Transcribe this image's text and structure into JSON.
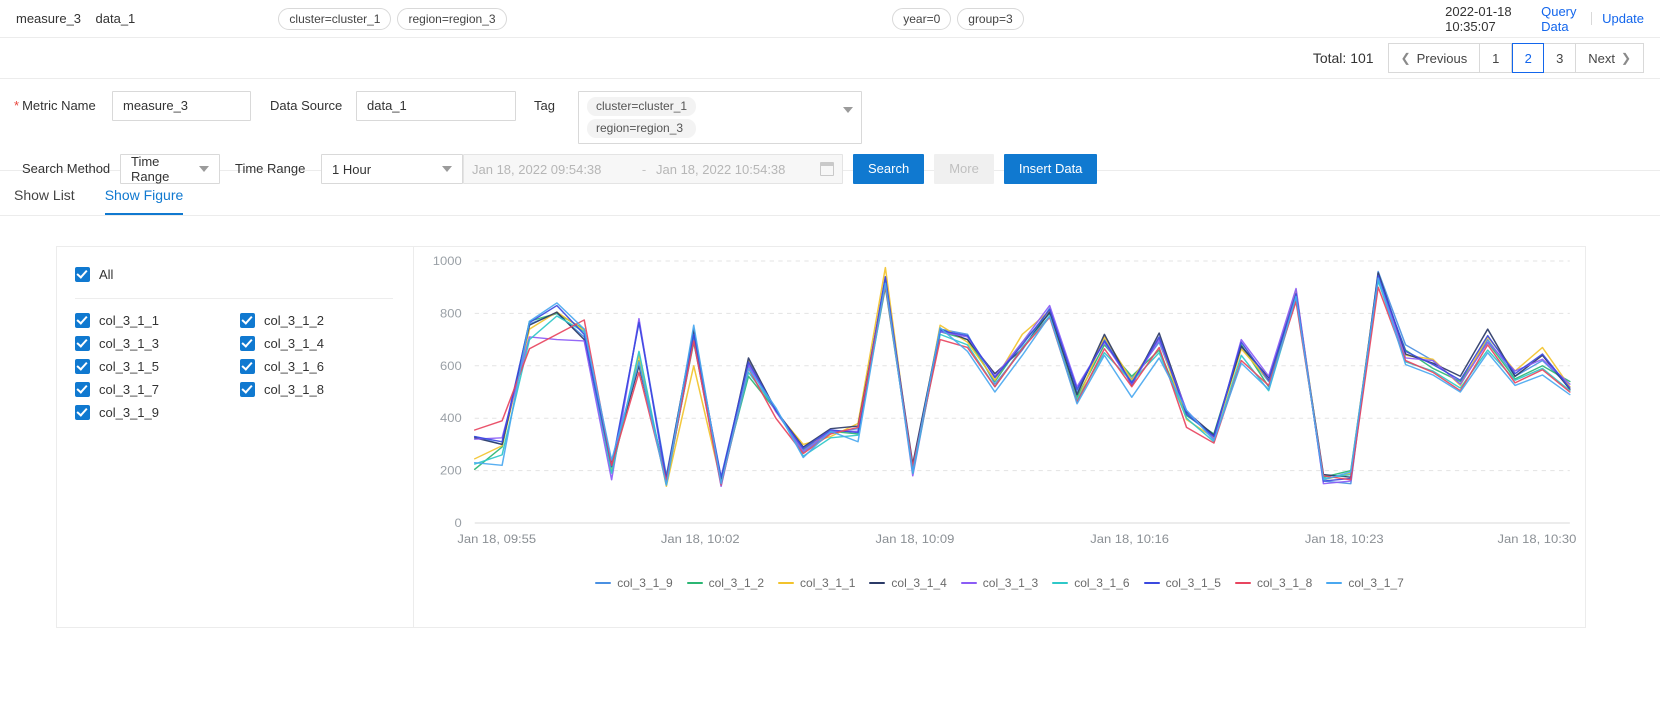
{
  "topbar": {
    "measure": "measure_3",
    "data_source": "data_1",
    "tags": [
      "cluster=cluster_1",
      "region=region_3"
    ],
    "tags2": [
      "year=0",
      "group=3"
    ],
    "timestamp": "2022-01-18 10:35:07",
    "query_data_link": "Query Data",
    "update_link": "Update"
  },
  "pagination": {
    "total_label": "Total: 101",
    "previous_label": "Previous",
    "next_label": "Next",
    "pages": [
      "1",
      "2",
      "3"
    ],
    "current_page": "2"
  },
  "form": {
    "metric_name_label": "Metric Name",
    "metric_name_value": "measure_3",
    "data_source_label": "Data Source",
    "data_source_value": "data_1",
    "tag_label": "Tag",
    "tag_values": [
      "cluster=cluster_1",
      "region=region_3"
    ],
    "search_method_label": "Search Method",
    "search_method_value": "Time Range",
    "time_range_label": "Time Range",
    "time_range_value": "1 Hour",
    "date_start_placeholder": "Jan 18, 2022 09:54:38",
    "date_sep": "-",
    "date_end_placeholder": "Jan 18, 2022 10:54:38",
    "search_button": "Search",
    "more_button": "More",
    "insert_data_button": "Insert Data"
  },
  "tabs": [
    {
      "label": "Show List",
      "active": false
    },
    {
      "label": "Show Figure",
      "active": true
    }
  ],
  "series_selector": {
    "all_label": "All",
    "items": [
      "col_3_1_1",
      "col_3_1_2",
      "col_3_1_3",
      "col_3_1_4",
      "col_3_1_5",
      "col_3_1_6",
      "col_3_1_7",
      "col_3_1_8",
      "col_3_1_9"
    ]
  },
  "chart_data": {
    "type": "line",
    "title": "",
    "xlabel": "",
    "ylabel": "",
    "ylim": [
      0,
      1000
    ],
    "yticks": [
      0,
      200,
      400,
      600,
      800,
      1000
    ],
    "grid": true,
    "legend_position": "bottom",
    "xticks": [
      "Jan 18, 09:55",
      "Jan 18, 10:02",
      "Jan 18, 10:09",
      "Jan 18, 10:16",
      "Jan 18, 10:23",
      "Jan 18, 10:30"
    ],
    "x": [
      0,
      1,
      2,
      3,
      4,
      5,
      6,
      7,
      8,
      9,
      10,
      11,
      12,
      13,
      14,
      15,
      16,
      17,
      18,
      19,
      20,
      21,
      22,
      23,
      24,
      25,
      26,
      27,
      28,
      29,
      30,
      31,
      32,
      33,
      34,
      35,
      36,
      37,
      38,
      39,
      40
    ],
    "series": [
      {
        "name": "col_3_1_9",
        "color": "#4a90e2",
        "values": [
          330,
          300,
          760,
          800,
          710,
          200,
          770,
          180,
          730,
          160,
          600,
          430,
          270,
          345,
          360,
          930,
          200,
          740,
          720,
          530,
          660,
          820,
          500,
          700,
          550,
          690,
          420,
          330,
          670,
          540,
          870,
          160,
          150,
          960,
          680,
          620,
          530,
          700,
          560,
          620,
          520
        ]
      },
      {
        "name": "col_3_1_2",
        "color": "#2bb673",
        "values": [
          205,
          290,
          770,
          800,
          740,
          210,
          620,
          160,
          690,
          165,
          560,
          430,
          280,
          350,
          340,
          900,
          210,
          730,
          700,
          540,
          690,
          800,
          480,
          680,
          560,
          660,
          410,
          340,
          680,
          520,
          880,
          175,
          200,
          930,
          660,
          590,
          540,
          690,
          550,
          600,
          540
        ]
      },
      {
        "name": "col_3_1_1",
        "color": "#f2c32c",
        "values": [
          245,
          295,
          740,
          805,
          735,
          195,
          640,
          140,
          600,
          155,
          620,
          425,
          300,
          330,
          380,
          975,
          195,
          755,
          690,
          545,
          720,
          810,
          465,
          710,
          545,
          705,
          395,
          325,
          665,
          545,
          890,
          165,
          190,
          950,
          640,
          625,
          525,
          710,
          580,
          670,
          520
        ]
      },
      {
        "name": "col_3_1_4",
        "color": "#2b3a67",
        "values": [
          325,
          300,
          755,
          805,
          700,
          230,
          600,
          170,
          740,
          160,
          630,
          430,
          290,
          360,
          370,
          920,
          225,
          740,
          700,
          570,
          665,
          805,
          490,
          720,
          525,
          725,
          425,
          335,
          675,
          555,
          860,
          185,
          175,
          955,
          645,
          610,
          560,
          740,
          560,
          640,
          510
        ]
      },
      {
        "name": "col_3_1_3",
        "color": "#8b5cf6",
        "values": [
          320,
          325,
          710,
          700,
          695,
          165,
          780,
          150,
          700,
          140,
          605,
          425,
          275,
          350,
          350,
          935,
          180,
          730,
          710,
          560,
          690,
          830,
          520,
          690,
          530,
          700,
          430,
          320,
          700,
          560,
          895,
          150,
          160,
          940,
          630,
          620,
          530,
          690,
          580,
          625,
          530
        ]
      },
      {
        "name": "col_3_1_6",
        "color": "#2ec8c8",
        "values": [
          225,
          260,
          700,
          790,
          730,
          190,
          655,
          145,
          710,
          150,
          575,
          435,
          255,
          325,
          335,
          925,
          190,
          720,
          680,
          520,
          670,
          790,
          470,
          650,
          540,
          650,
          400,
          310,
          640,
          505,
          855,
          170,
          185,
          925,
          615,
          580,
          515,
          660,
          545,
          590,
          505
        ]
      },
      {
        "name": "col_3_1_5",
        "color": "#3b49df",
        "values": [
          330,
          310,
          765,
          830,
          720,
          215,
          765,
          170,
          720,
          175,
          615,
          430,
          285,
          355,
          345,
          940,
          205,
          735,
          715,
          555,
          680,
          815,
          510,
          695,
          535,
          710,
          415,
          330,
          690,
          545,
          875,
          160,
          170,
          945,
          655,
          605,
          545,
          715,
          570,
          645,
          515
        ]
      },
      {
        "name": "col_3_1_8",
        "color": "#e8455f",
        "values": [
          355,
          390,
          665,
          720,
          775,
          220,
          575,
          160,
          695,
          145,
          590,
          400,
          265,
          340,
          365,
          905,
          215,
          700,
          670,
          520,
          665,
          785,
          460,
          665,
          520,
          670,
          365,
          305,
          620,
          525,
          845,
          180,
          165,
          900,
          620,
          575,
          505,
          680,
          535,
          585,
          500
        ]
      },
      {
        "name": "col_3_1_7",
        "color": "#4aa8f0",
        "values": [
          230,
          220,
          770,
          840,
          740,
          240,
          615,
          145,
          755,
          150,
          590,
          440,
          250,
          350,
          310,
          915,
          195,
          745,
          655,
          500,
          640,
          790,
          455,
          640,
          480,
          630,
          430,
          315,
          610,
          510,
          865,
          165,
          195,
          935,
          605,
          565,
          500,
          650,
          525,
          565,
          490
        ]
      }
    ]
  }
}
